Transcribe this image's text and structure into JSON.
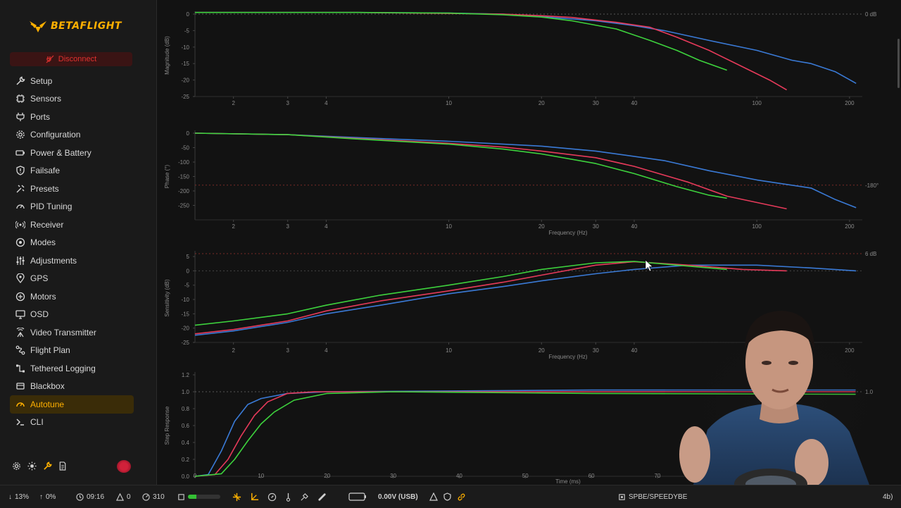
{
  "app": {
    "logo_text": "BETAFLIGHT",
    "disconnect_label": "Disconnect"
  },
  "sidebar": {
    "items": [
      {
        "label": "Setup",
        "icon": "wrench-icon",
        "active": false
      },
      {
        "label": "Sensors",
        "icon": "chip-icon",
        "active": false
      },
      {
        "label": "Ports",
        "icon": "plug-icon",
        "active": false
      },
      {
        "label": "Configuration",
        "icon": "gear-icon",
        "active": false
      },
      {
        "label": "Power & Battery",
        "icon": "battery-icon",
        "active": false
      },
      {
        "label": "Failsafe",
        "icon": "shield-icon",
        "active": false
      },
      {
        "label": "Presets",
        "icon": "presets-icon",
        "active": false
      },
      {
        "label": "PID Tuning",
        "icon": "gauge-icon",
        "active": false
      },
      {
        "label": "Receiver",
        "icon": "antenna-icon",
        "active": false
      },
      {
        "label": "Modes",
        "icon": "toggle-icon",
        "active": false
      },
      {
        "label": "Adjustments",
        "icon": "sliders-icon",
        "active": false
      },
      {
        "label": "GPS",
        "icon": "location-pin-icon",
        "active": false
      },
      {
        "label": "Motors",
        "icon": "motor-icon",
        "active": false
      },
      {
        "label": "OSD",
        "icon": "monitor-icon",
        "active": false
      },
      {
        "label": "Video Transmitter",
        "icon": "broadcast-icon",
        "active": false
      },
      {
        "label": "Flight Plan",
        "icon": "route-icon",
        "active": false
      },
      {
        "label": "Tethered Logging",
        "icon": "cable-icon",
        "active": false
      },
      {
        "label": "Blackbox",
        "icon": "blackbox-icon",
        "active": false
      },
      {
        "label": "Autotune",
        "icon": "autotune-gauge-icon",
        "active": true
      },
      {
        "label": "CLI",
        "icon": "terminal-icon",
        "active": false
      }
    ]
  },
  "sidebar_tools": [
    "settings-gear-icon",
    "sun-icon",
    "wrench-tool-icon",
    "document-icon"
  ],
  "colors": {
    "accent": "#ffb000",
    "disconnect": "#e0312e",
    "roll_trace": "#e63a5a",
    "pitch_trace": "#3dd23d",
    "yaw_trace": "#3a7ad6",
    "reference_line": "#c0302a"
  },
  "status_bar": {
    "cpu_down": "13%",
    "cpu_up": "0%",
    "time": "09:16",
    "warnings": "0",
    "cycle": "310",
    "battery_level": 0.25,
    "voltage": "0.00V (USB)",
    "device": "SPBE/SPEEDYBE",
    "tail": "4b)"
  },
  "chart_data": [
    {
      "type": "line",
      "name": "magnitude",
      "ylabel": "Magnitude (dB)",
      "xlabel": "",
      "x_scale": "log",
      "xlim": [
        1.5,
        220
      ],
      "ylim": [
        -25,
        0
      ],
      "x_ticks": [
        2,
        3,
        4,
        10,
        20,
        30,
        40,
        100,
        200
      ],
      "y_ticks": [
        0,
        -5,
        -10,
        -15,
        -20,
        -25
      ],
      "reference": {
        "value": 0,
        "label": "0 dB"
      },
      "series": [
        {
          "color": "#3a7ad6",
          "points": [
            [
              1.5,
              0.5
            ],
            [
              5,
              0.5
            ],
            [
              10,
              0.3
            ],
            [
              15,
              0
            ],
            [
              20,
              -0.8
            ],
            [
              30,
              -2
            ],
            [
              40,
              -3.5
            ],
            [
              50,
              -5
            ],
            [
              70,
              -8
            ],
            [
              100,
              -11
            ],
            [
              130,
              -14
            ],
            [
              150,
              -15
            ],
            [
              180,
              -17.5
            ],
            [
              210,
              -21
            ]
          ]
        },
        {
          "color": "#e63a5a",
          "points": [
            [
              1.5,
              0.5
            ],
            [
              5,
              0.5
            ],
            [
              10,
              0.2
            ],
            [
              15,
              0
            ],
            [
              20,
              -0.5
            ],
            [
              25,
              -1
            ],
            [
              35,
              -2.5
            ],
            [
              45,
              -4
            ],
            [
              55,
              -7
            ],
            [
              70,
              -11
            ],
            [
              90,
              -16
            ],
            [
              110,
              -20
            ],
            [
              125,
              -23
            ]
          ]
        },
        {
          "color": "#3dd23d",
          "points": [
            [
              1.5,
              0.5
            ],
            [
              5,
              0.5
            ],
            [
              10,
              0.3
            ],
            [
              15,
              -0.2
            ],
            [
              20,
              -0.9
            ],
            [
              25,
              -2
            ],
            [
              35,
              -4.5
            ],
            [
              45,
              -8
            ],
            [
              55,
              -11
            ],
            [
              65,
              -14
            ],
            [
              80,
              -17
            ]
          ]
        }
      ]
    },
    {
      "type": "line",
      "name": "phase",
      "ylabel": "Phase (°)",
      "xlabel": "Frequency (Hz)",
      "x_scale": "log",
      "xlim": [
        1.5,
        220
      ],
      "ylim": [
        -300,
        0
      ],
      "x_ticks": [
        2,
        3,
        4,
        10,
        20,
        30,
        40,
        100,
        200
      ],
      "y_ticks": [
        0,
        -50,
        -100,
        -150,
        -200,
        -250
      ],
      "reference": {
        "value": -180,
        "label": "-180°"
      },
      "series": [
        {
          "color": "#3a7ad6",
          "points": [
            [
              1.5,
              0
            ],
            [
              3,
              -5
            ],
            [
              5,
              -15
            ],
            [
              10,
              -28
            ],
            [
              20,
              -45
            ],
            [
              30,
              -62
            ],
            [
              50,
              -95
            ],
            [
              70,
              -130
            ],
            [
              100,
              -162
            ],
            [
              150,
              -190
            ],
            [
              180,
              -230
            ],
            [
              210,
              -258
            ]
          ]
        },
        {
          "color": "#e63a5a",
          "points": [
            [
              1.5,
              0
            ],
            [
              3,
              -5
            ],
            [
              5,
              -18
            ],
            [
              10,
              -35
            ],
            [
              15,
              -48
            ],
            [
              20,
              -62
            ],
            [
              30,
              -85
            ],
            [
              40,
              -115
            ],
            [
              60,
              -170
            ],
            [
              80,
              -218
            ],
            [
              100,
              -240
            ],
            [
              125,
              -262
            ]
          ]
        },
        {
          "color": "#3dd23d",
          "points": [
            [
              1.5,
              0
            ],
            [
              3,
              -5
            ],
            [
              5,
              -20
            ],
            [
              10,
              -38
            ],
            [
              15,
              -55
            ],
            [
              20,
              -72
            ],
            [
              30,
              -105
            ],
            [
              40,
              -140
            ],
            [
              55,
              -185
            ],
            [
              70,
              -215
            ],
            [
              80,
              -225
            ]
          ]
        }
      ]
    },
    {
      "type": "line",
      "name": "sensitivity",
      "ylabel": "Sensitivity (dB)",
      "xlabel": "Frequency (Hz)",
      "x_scale": "log",
      "xlim": [
        1.5,
        220
      ],
      "ylim": [
        -25,
        5
      ],
      "x_ticks": [
        2,
        3,
        4,
        10,
        20,
        30,
        40,
        100,
        200
      ],
      "y_ticks": [
        5,
        0,
        -5,
        -10,
        -15,
        -20,
        -25
      ],
      "reference": {
        "value": 6,
        "label": "6 dB"
      },
      "series": [
        {
          "color": "#3a7ad6",
          "points": [
            [
              1.5,
              -22.5
            ],
            [
              2,
              -21
            ],
            [
              3,
              -18
            ],
            [
              4,
              -15
            ],
            [
              6,
              -12
            ],
            [
              10,
              -8
            ],
            [
              15,
              -5.5
            ],
            [
              20,
              -3.5
            ],
            [
              30,
              -1
            ],
            [
              40,
              0.5
            ],
            [
              60,
              2
            ],
            [
              100,
              2
            ],
            [
              150,
              1
            ],
            [
              210,
              0
            ]
          ]
        },
        {
          "color": "#e63a5a",
          "points": [
            [
              1.5,
              -22
            ],
            [
              2,
              -20.5
            ],
            [
              3,
              -17.5
            ],
            [
              4,
              -14
            ],
            [
              6,
              -10.5
            ],
            [
              10,
              -7
            ],
            [
              15,
              -4
            ],
            [
              20,
              -1.5
            ],
            [
              30,
              2
            ],
            [
              40,
              3.2
            ],
            [
              60,
              2
            ],
            [
              90,
              0.5
            ],
            [
              125,
              0
            ]
          ]
        },
        {
          "color": "#3dd23d",
          "points": [
            [
              1.5,
              -19
            ],
            [
              2,
              -17.5
            ],
            [
              3,
              -15
            ],
            [
              4,
              -12
            ],
            [
              6,
              -8.5
            ],
            [
              10,
              -5
            ],
            [
              15,
              -2
            ],
            [
              20,
              0.5
            ],
            [
              30,
              2.8
            ],
            [
              40,
              3.3
            ],
            [
              55,
              2
            ],
            [
              80,
              0.5
            ]
          ]
        }
      ]
    },
    {
      "type": "line",
      "name": "step-response",
      "ylabel": "Step Response",
      "xlabel": "Time (ms)",
      "x_scale": "linear",
      "xlim": [
        0,
        101
      ],
      "ylim": [
        0,
        1.2
      ],
      "x_ticks": [
        0,
        10,
        20,
        30,
        40,
        50,
        60,
        70,
        80,
        90,
        100
      ],
      "y_ticks": [
        1.2,
        1.0,
        0.8,
        0.6,
        0.4,
        0.2,
        0.0
      ],
      "reference": {
        "value": 1.0,
        "label": "1.0"
      },
      "series": [
        {
          "color": "#3a7ad6",
          "points": [
            [
              0,
              0
            ],
            [
              2,
              0.02
            ],
            [
              4,
              0.3
            ],
            [
              6,
              0.65
            ],
            [
              8,
              0.85
            ],
            [
              10,
              0.92
            ],
            [
              14,
              0.98
            ],
            [
              20,
              1.0
            ],
            [
              40,
              1.01
            ],
            [
              60,
              1.02
            ],
            [
              80,
              1.02
            ],
            [
              100,
              1.02
            ]
          ]
        },
        {
          "color": "#e63a5a",
          "points": [
            [
              0,
              0
            ],
            [
              3,
              0.02
            ],
            [
              5,
              0.2
            ],
            [
              7,
              0.48
            ],
            [
              9,
              0.72
            ],
            [
              11,
              0.88
            ],
            [
              14,
              0.98
            ],
            [
              18,
              1.0
            ],
            [
              30,
              1.0
            ],
            [
              60,
              1.0
            ],
            [
              100,
              1.0
            ]
          ]
        },
        {
          "color": "#3dd23d",
          "points": [
            [
              0,
              0
            ],
            [
              4,
              0.03
            ],
            [
              6,
              0.2
            ],
            [
              8,
              0.42
            ],
            [
              10,
              0.62
            ],
            [
              12,
              0.76
            ],
            [
              15,
              0.9
            ],
            [
              20,
              0.98
            ],
            [
              30,
              1.0
            ],
            [
              60,
              0.98
            ],
            [
              100,
              0.97
            ]
          ]
        }
      ]
    }
  ]
}
